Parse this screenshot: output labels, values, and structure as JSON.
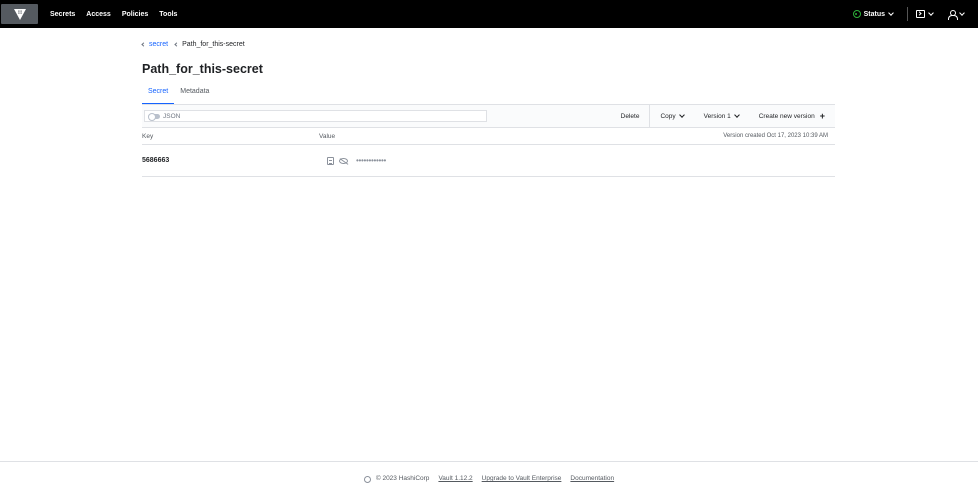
{
  "nav": {
    "links": [
      "Secrets",
      "Access",
      "Policies",
      "Tools"
    ],
    "status_label": "Status",
    "status_color": "#2eb039",
    "logo_icon": "vault-logo-icon",
    "console_icon": "terminal-icon",
    "user_icon": "user-icon"
  },
  "breadcrumb": {
    "parent": "secret",
    "current": "Path_for_this-secret"
  },
  "page": {
    "title": "Path_for_this-secret"
  },
  "tabs": [
    {
      "label": "Secret",
      "active": true
    },
    {
      "label": "Metadata",
      "active": false
    }
  ],
  "toolbar": {
    "json_label": "JSON",
    "json_toggle_on": false,
    "delete_label": "Delete",
    "copy_label": "Copy",
    "version_label": "Version 1",
    "create_label": "Create new version"
  },
  "table": {
    "key_header": "Key",
    "value_header": "Value",
    "version_created": "Version created Oct 17, 2023 10:39 AM",
    "rows": [
      {
        "key": "5686663",
        "value_masked": "••••••••••••"
      }
    ]
  },
  "footer": {
    "copyright": "© 2023 HashiCorp",
    "version_link": "Vault 1.12.2",
    "upgrade_link": "Upgrade to Vault Enterprise",
    "docs_link": "Documentation"
  },
  "colors": {
    "accent": "#1563ff",
    "nav_bg": "#000000"
  }
}
